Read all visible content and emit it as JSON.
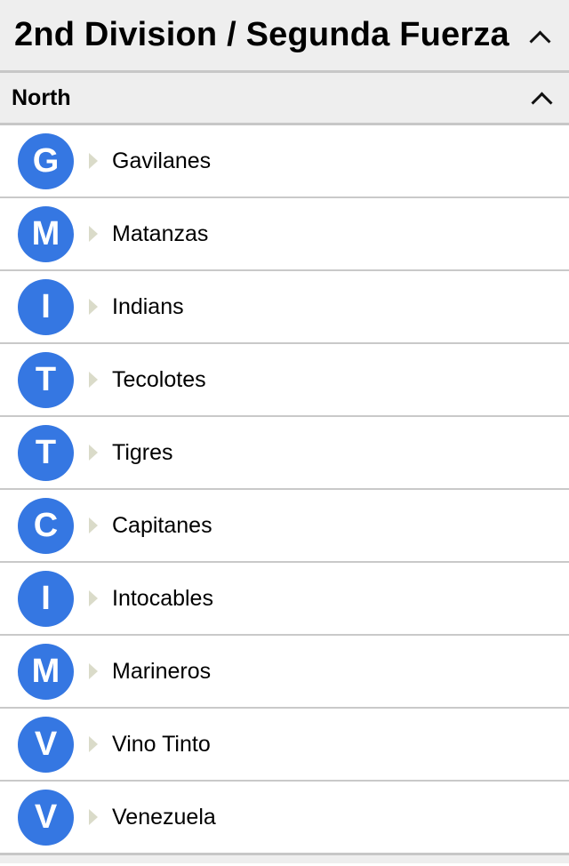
{
  "division": {
    "title": "2nd Division / Segunda Fuerza",
    "collapse_icon": "chevron-up-icon"
  },
  "section": {
    "title": "North",
    "collapse_icon": "chevron-up-icon"
  },
  "colors": {
    "avatar_bg": "#3577e2",
    "header_bg": "#eeeeee",
    "caret": "#dadbc9"
  },
  "teams": [
    {
      "initial": "G",
      "name": "Gavilanes"
    },
    {
      "initial": "M",
      "name": "Matanzas"
    },
    {
      "initial": "I",
      "name": "Indians"
    },
    {
      "initial": "T",
      "name": "Tecolotes"
    },
    {
      "initial": "T",
      "name": "Tigres"
    },
    {
      "initial": "C",
      "name": "Capitanes"
    },
    {
      "initial": "I",
      "name": "Intocables"
    },
    {
      "initial": "M",
      "name": "Marineros"
    },
    {
      "initial": "V",
      "name": "Vino Tinto"
    },
    {
      "initial": "V",
      "name": "Venezuela"
    }
  ]
}
